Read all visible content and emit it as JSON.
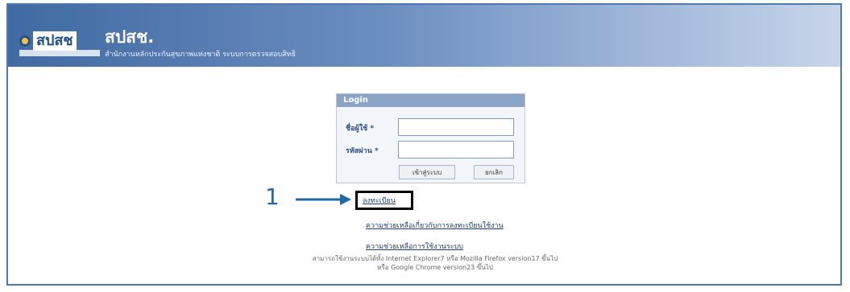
{
  "brand": {
    "logo": "สปสช",
    "name": "สปสช.",
    "subtitle": "สำนักงานหลักประกันสุขภาพแห่งชาติ ระบบการตรวจสอบสิทธิ"
  },
  "login": {
    "header": "Login",
    "username_label": "ชื่อผู้ใช้ *",
    "password_label": "รหัสผ่าน *",
    "login_button": "เข้าสู่ระบบ",
    "cancel_button": "ยกเลิก"
  },
  "links": {
    "register": "ลงทะเบียน",
    "forgot": "ความช่วยเหลือเกี่ยวกับการลงทะเบียนใช้งาน",
    "manual": "ความช่วยเหลือการใช้งานระบบ"
  },
  "footer": {
    "line1": "สามารถใช้งานระบบได้ทั้ง Internet Explorer7 หรือ Mozilla Firefox version17 ขึ้นไป",
    "line2": "หรือ Google Chrome version23 ขึ้นไป"
  },
  "annotation": {
    "label": "1",
    "color": "#1f69ab"
  }
}
